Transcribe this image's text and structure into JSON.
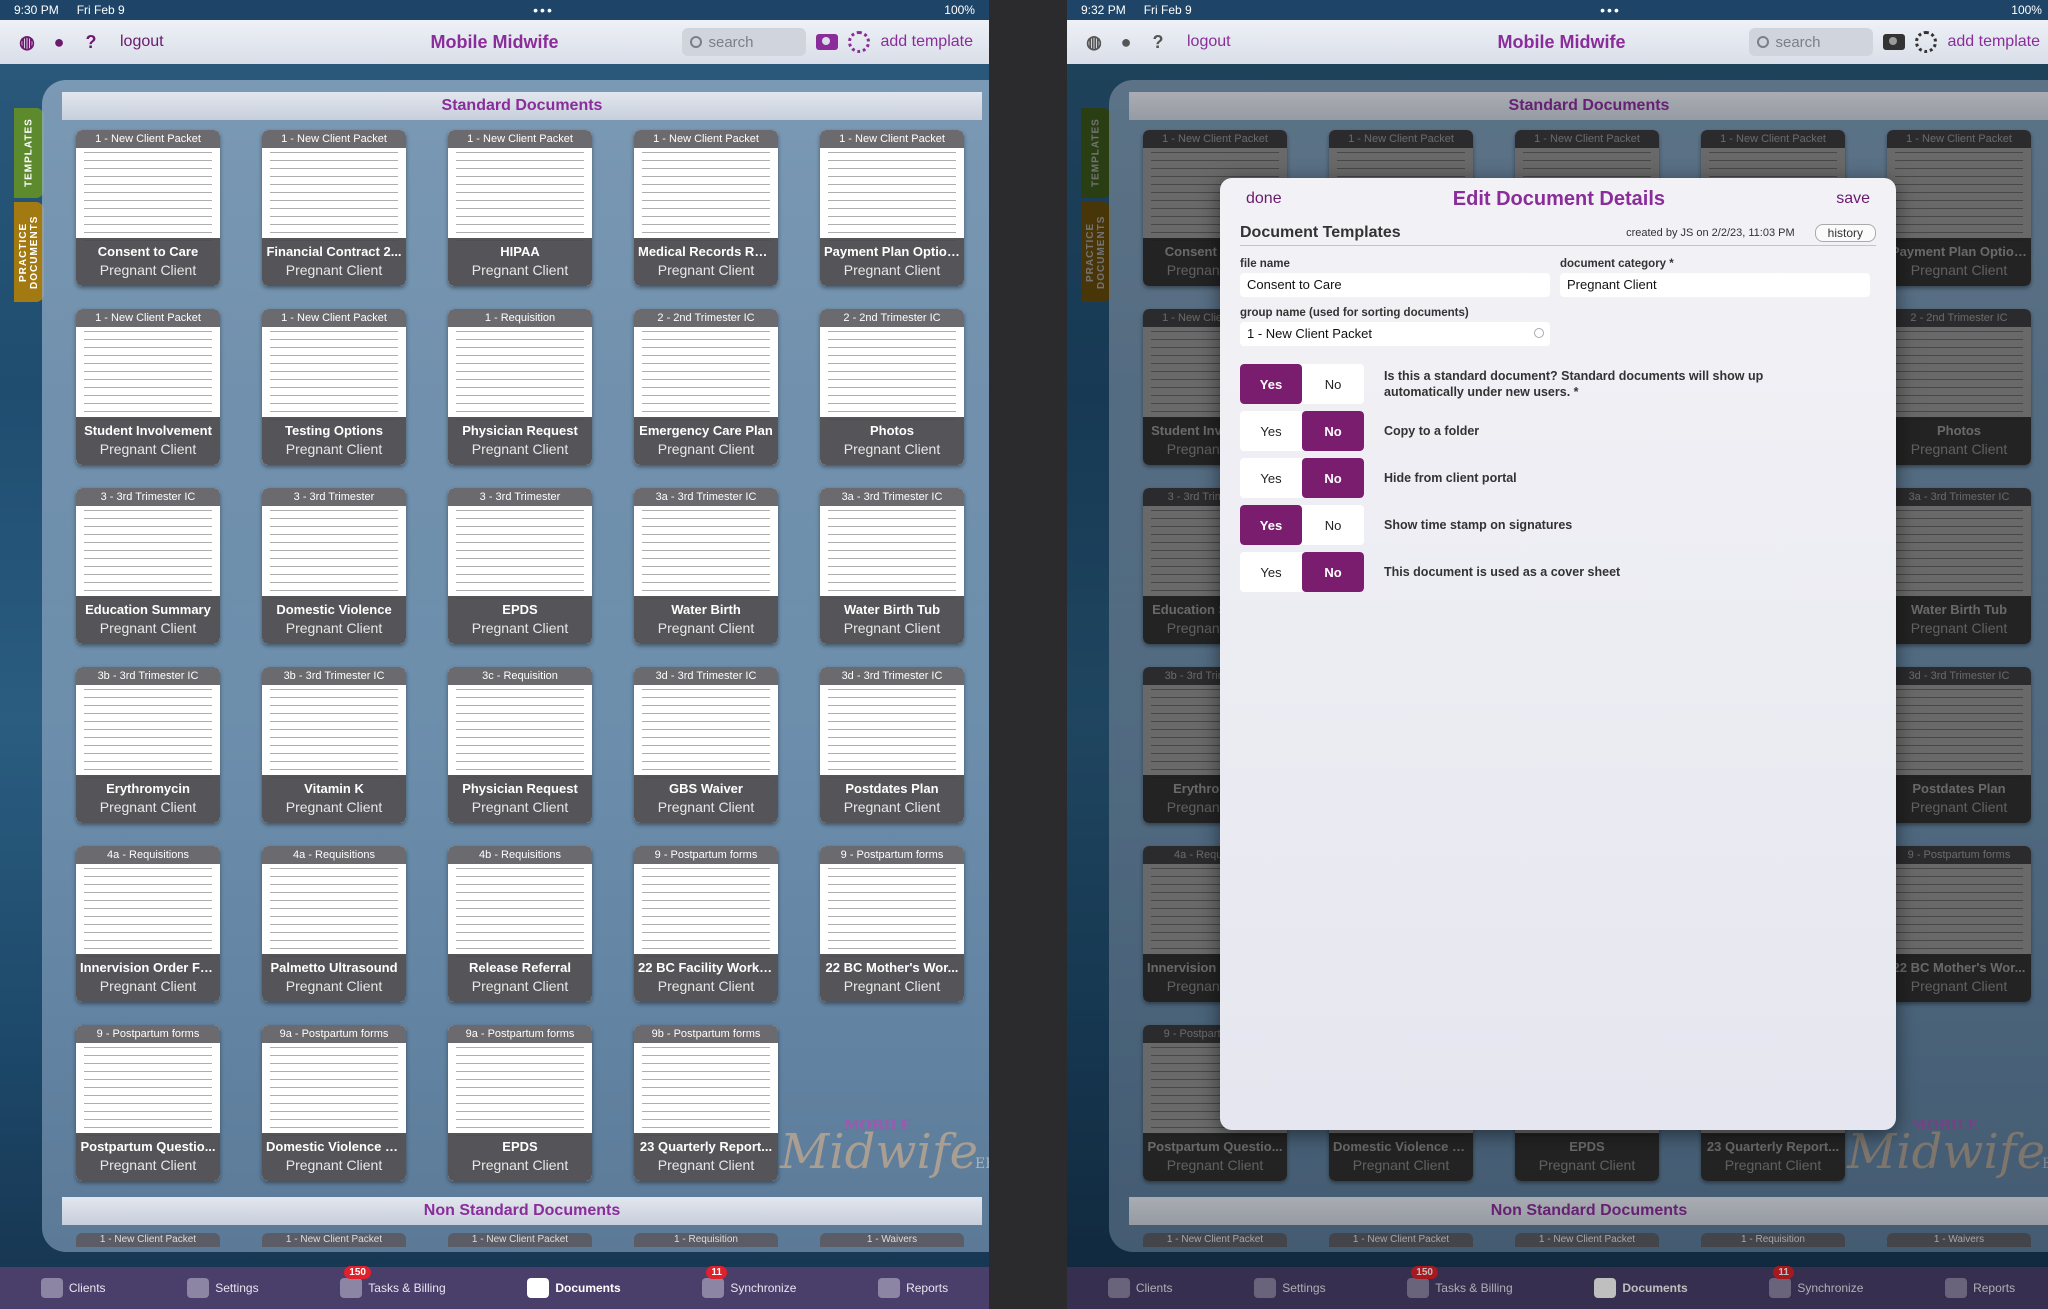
{
  "left": {
    "status": {
      "time": "9:30 PM",
      "date": "Fri Feb 9",
      "battery": "100%"
    },
    "nav": {
      "logout": "logout",
      "title": "Mobile Midwife",
      "search_placeholder": "search",
      "add_template": "add template"
    },
    "side_tabs": {
      "templates": "TEMPLATES",
      "practice": "PRACTICE DOCUMENTS"
    },
    "standard_header": "Standard Documents",
    "non_standard_header": "Non Standard Documents",
    "cards": [
      {
        "group": "1 - New Client Packet",
        "title": "Consent to Care",
        "category": "Pregnant Client"
      },
      {
        "group": "1 - New Client Packet",
        "title": "Financial Contract 2...",
        "category": "Pregnant Client"
      },
      {
        "group": "1 - New Client Packet",
        "title": "HIPAA",
        "category": "Pregnant Client"
      },
      {
        "group": "1 - New Client Packet",
        "title": "Medical Records Rel...",
        "category": "Pregnant Client"
      },
      {
        "group": "1 - New Client Packet",
        "title": "Payment Plan Options",
        "category": "Pregnant Client"
      },
      {
        "group": "1 - New Client Packet",
        "title": "Student Involvement",
        "category": "Pregnant Client"
      },
      {
        "group": "1 - New Client Packet",
        "title": "Testing Options",
        "category": "Pregnant Client"
      },
      {
        "group": "1 - Requisition",
        "title": "Physician Request",
        "category": "Pregnant Client"
      },
      {
        "group": "2 - 2nd Trimester IC",
        "title": "Emergency Care Plan",
        "category": "Pregnant Client"
      },
      {
        "group": "2 - 2nd Trimester IC",
        "title": "Photos",
        "category": "Pregnant Client"
      },
      {
        "group": "3 - 3rd Trimester IC",
        "title": "Education Summary",
        "category": "Pregnant Client"
      },
      {
        "group": "3 - 3rd Trimester",
        "title": "Domestic Violence",
        "category": "Pregnant Client"
      },
      {
        "group": "3 - 3rd Trimester",
        "title": "EPDS",
        "category": "Pregnant Client"
      },
      {
        "group": "3a - 3rd Trimester IC",
        "title": "Water Birth",
        "category": "Pregnant Client"
      },
      {
        "group": "3a - 3rd Trimester IC",
        "title": "Water Birth Tub",
        "category": "Pregnant Client"
      },
      {
        "group": "3b - 3rd Trimester IC",
        "title": "Erythromycin",
        "category": "Pregnant Client"
      },
      {
        "group": "3b - 3rd Trimester IC",
        "title": "Vitamin K",
        "category": "Pregnant Client"
      },
      {
        "group": "3c - Requisition",
        "title": "Physician Request",
        "category": "Pregnant Client"
      },
      {
        "group": "3d - 3rd Trimester IC",
        "title": "GBS Waiver",
        "category": "Pregnant Client"
      },
      {
        "group": "3d - 3rd Trimester IC",
        "title": "Postdates Plan",
        "category": "Pregnant Client"
      },
      {
        "group": "4a - Requisitions",
        "title": "Innervision Order Fo...",
        "category": "Pregnant Client"
      },
      {
        "group": "4a - Requisitions",
        "title": "Palmetto Ultrasound",
        "category": "Pregnant Client"
      },
      {
        "group": "4b - Requisitions",
        "title": "Release Referral",
        "category": "Pregnant Client"
      },
      {
        "group": "9 - Postpartum forms",
        "title": "22 BC Facility Works...",
        "category": "Pregnant Client"
      },
      {
        "group": "9 - Postpartum forms",
        "title": "22 BC Mother's Wor...",
        "category": "Pregnant Client"
      },
      {
        "group": "9 - Postpartum forms",
        "title": "Postpartum Questio...",
        "category": "Pregnant Client"
      },
      {
        "group": "9a - Postpartum forms",
        "title": "Domestic Violence S...",
        "category": "Pregnant Client"
      },
      {
        "group": "9a - Postpartum forms",
        "title": "EPDS",
        "category": "Pregnant Client"
      },
      {
        "group": "9b - Postpartum forms",
        "title": "23 Quarterly Report...",
        "category": "Pregnant Client"
      }
    ],
    "peek": [
      "1 - New Client Packet",
      "1 - New Client Packet",
      "1 - New Client Packet",
      "1 - Requisition",
      "1 - Waivers"
    ],
    "tabbar": [
      {
        "label": "Clients",
        "badge": ""
      },
      {
        "label": "Settings",
        "badge": ""
      },
      {
        "label": "Tasks & Billing",
        "badge": "150"
      },
      {
        "label": "Documents",
        "badge": ""
      },
      {
        "label": "Synchronize",
        "badge": "11"
      },
      {
        "label": "Reports",
        "badge": ""
      }
    ]
  },
  "right": {
    "status": {
      "time": "9:32 PM",
      "date": "Fri Feb 9",
      "battery": "100%"
    },
    "modal": {
      "done": "done",
      "title": "Edit Document Details",
      "save": "save",
      "section": "Document Templates",
      "created": "created by JS on 2/2/23, 11:03 PM",
      "history": "history",
      "file_name_label": "file name",
      "file_name_value": "Consent to Care",
      "category_label": "document category *",
      "category_value": "Pregnant Client",
      "group_label": "group name (used for sorting documents)",
      "group_value": "1 - New Client Packet",
      "yes": "Yes",
      "no": "No",
      "toggles": [
        {
          "text": "Is this a standard document?  Standard documents will show up automatically under new users. *",
          "selected": "Yes"
        },
        {
          "text": "Copy to a folder",
          "selected": "No"
        },
        {
          "text": "Hide from client portal",
          "selected": "No"
        },
        {
          "text": "Show time stamp on signatures",
          "selected": "Yes"
        },
        {
          "text": "This document is used as a cover sheet",
          "selected": "No"
        }
      ]
    }
  },
  "logo": {
    "main": "Midwife",
    "top": "MOBILE",
    "suffix": "EHR"
  },
  "colors": {
    "accent": "#8a2d9a",
    "toggle_on": "#7a1d6e",
    "tabbar": "#4a3f6a",
    "badge": "#e0202a"
  }
}
